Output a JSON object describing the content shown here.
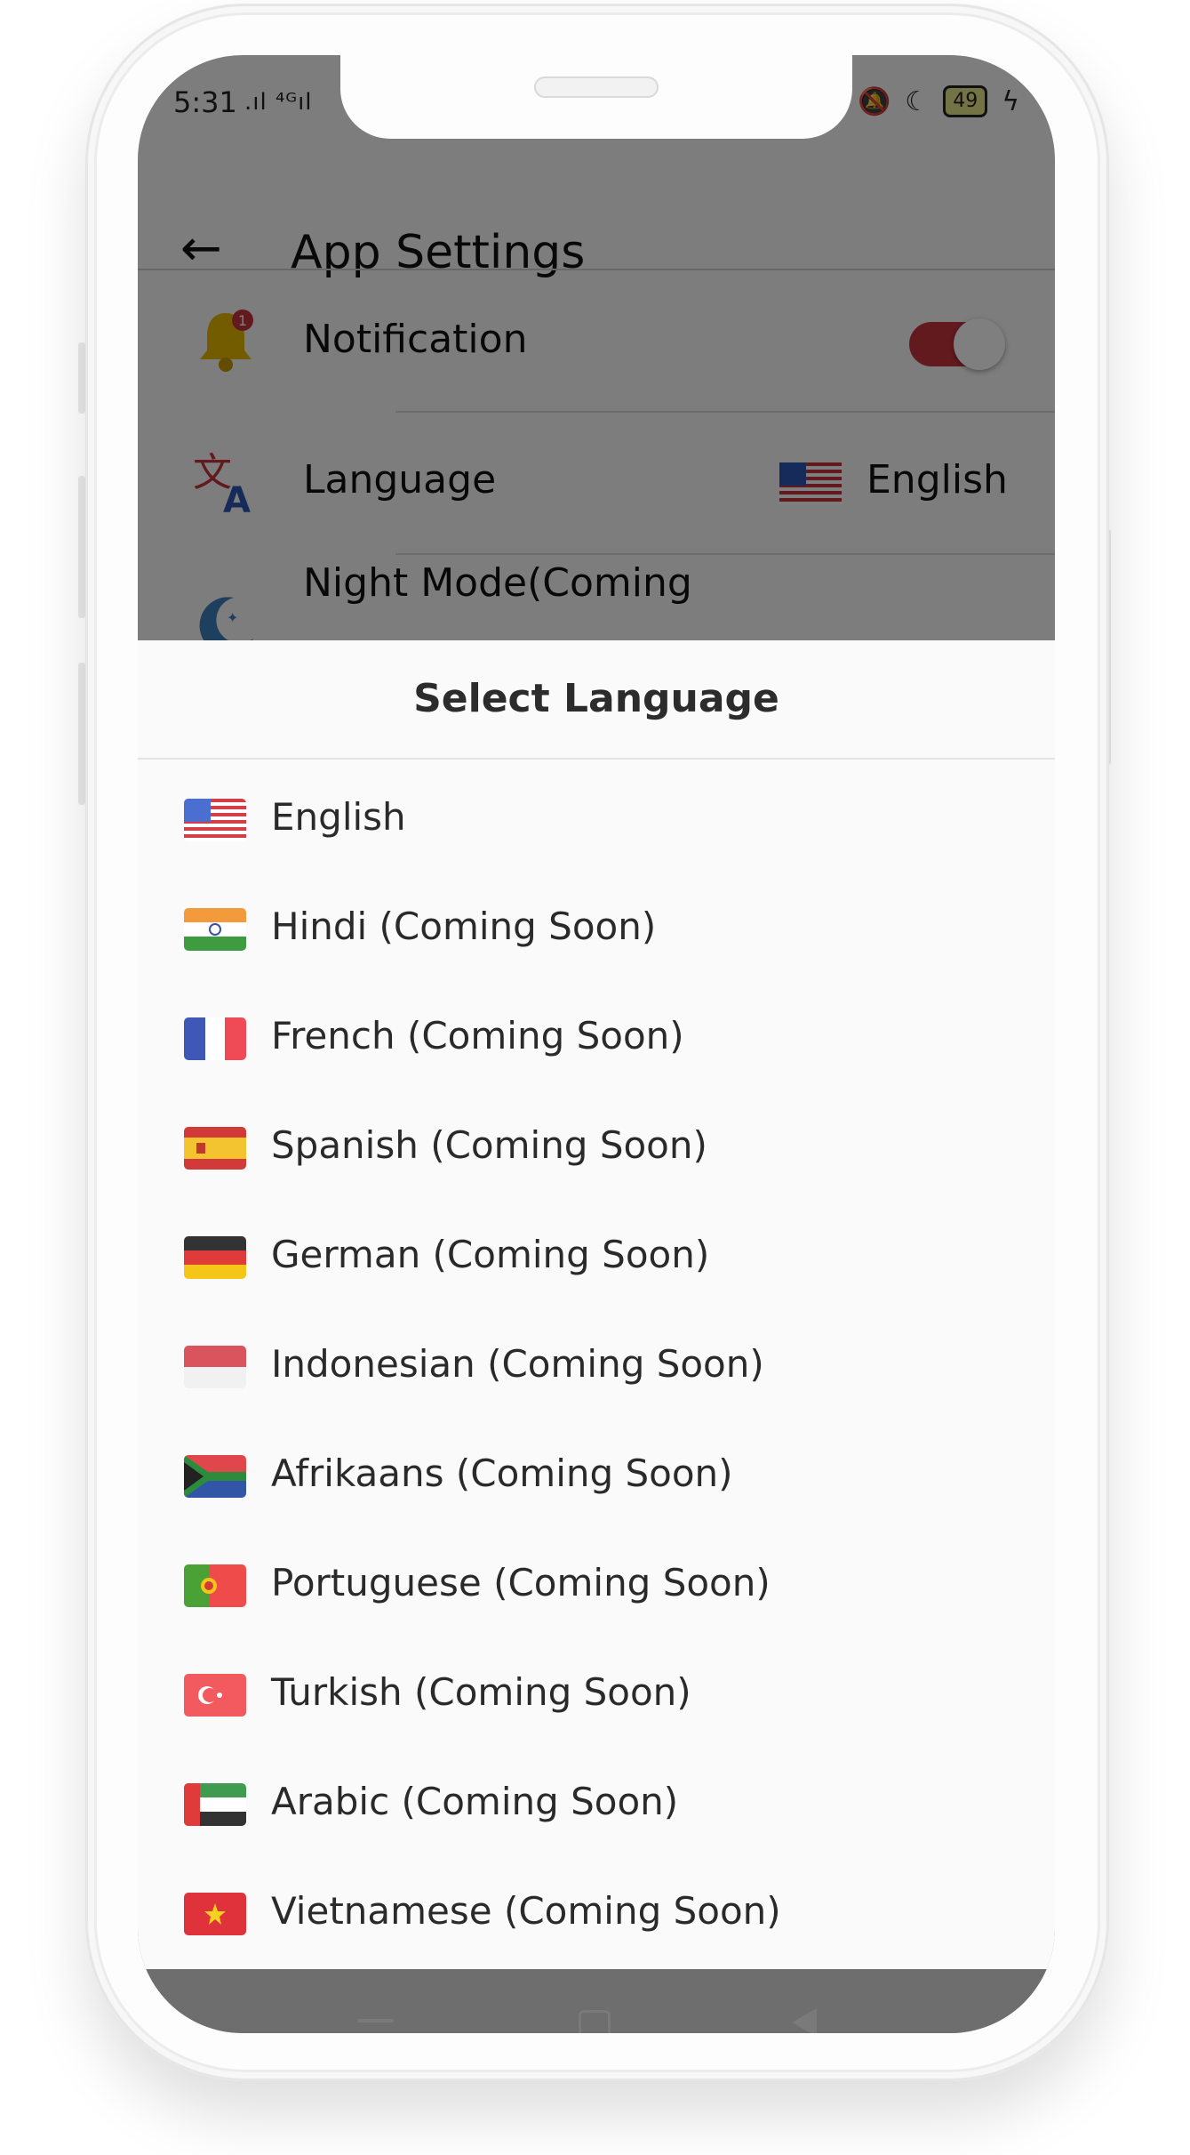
{
  "status_bar": {
    "time": "5:31",
    "signal": ".ıl  ⁴ᴳıl",
    "battery": "49"
  },
  "app_bar": {
    "back_icon": "arrow-left-icon",
    "title": "App Settings"
  },
  "settings": [
    {
      "icon": "bell-icon",
      "label": "Notification",
      "control": "toggle",
      "on": true,
      "badge": "1"
    },
    {
      "icon": "translate-icon",
      "label": "Language",
      "control": "value",
      "value": "English",
      "flag": "us"
    },
    {
      "icon": "moon-icon",
      "label": "Night Mode(Coming",
      "control": "toggle",
      "on": false
    }
  ],
  "language_sheet": {
    "title": "Select Language",
    "languages": [
      {
        "flag": "us",
        "label": "English"
      },
      {
        "flag": "in",
        "label": "Hindi (Coming Soon)"
      },
      {
        "flag": "fr",
        "label": "French (Coming Soon)"
      },
      {
        "flag": "es",
        "label": "Spanish (Coming Soon)"
      },
      {
        "flag": "de",
        "label": "German (Coming Soon)"
      },
      {
        "flag": "id",
        "label": "Indonesian (Coming Soon)"
      },
      {
        "flag": "za",
        "label": "Afrikaans (Coming Soon)"
      },
      {
        "flag": "pt",
        "label": "Portuguese (Coming Soon)"
      },
      {
        "flag": "tr",
        "label": "Turkish (Coming Soon)"
      },
      {
        "flag": "ae",
        "label": "Arabic (Coming Soon)"
      },
      {
        "flag": "vn",
        "label": "Vietnamese (Coming Soon)"
      }
    ]
  },
  "colors": {
    "accent": "#c4343f",
    "overlay": "rgba(0,0,0,0.5)"
  }
}
